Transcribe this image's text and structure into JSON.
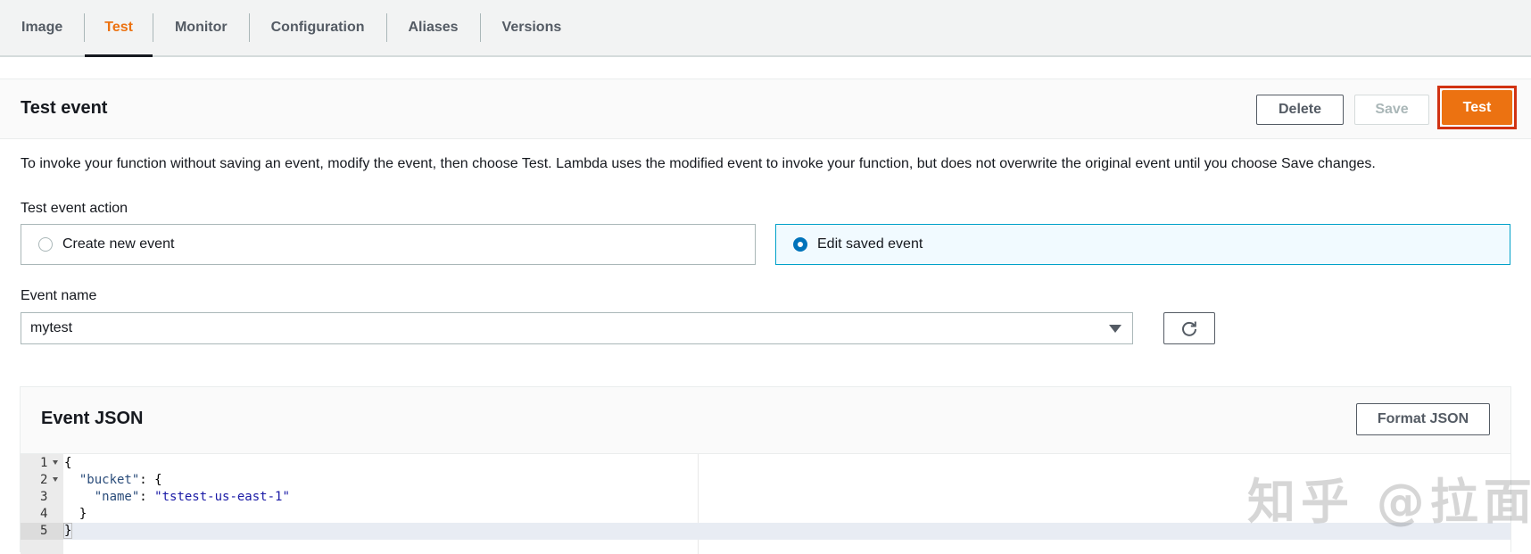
{
  "tabs": [
    {
      "label": "Image",
      "active": false
    },
    {
      "label": "Test",
      "active": true
    },
    {
      "label": "Monitor",
      "active": false
    },
    {
      "label": "Configuration",
      "active": false
    },
    {
      "label": "Aliases",
      "active": false
    },
    {
      "label": "Versions",
      "active": false
    }
  ],
  "header": {
    "title": "Test event",
    "delete_label": "Delete",
    "save_label": "Save",
    "test_label": "Test"
  },
  "description": "To invoke your function without saving an event, modify the event, then choose Test. Lambda uses the modified event to invoke your function, but does not overwrite the original event until you choose Save changes.",
  "test_event_action": {
    "label": "Test event action",
    "options": [
      {
        "label": "Create new event",
        "selected": false
      },
      {
        "label": "Edit saved event",
        "selected": true
      }
    ]
  },
  "event_name": {
    "label": "Event name",
    "value": "mytest"
  },
  "event_json": {
    "title": "Event JSON",
    "format_label": "Format JSON",
    "lines": [
      {
        "num": "1"
      },
      {
        "num": "2"
      },
      {
        "num": "3"
      },
      {
        "num": "4"
      },
      {
        "num": "5"
      }
    ],
    "key_bucket": "\"bucket\"",
    "key_name": "\"name\"",
    "value_name": "\"tstest-us-east-1\""
  },
  "watermark": "知乎 @拉面",
  "colors": {
    "accent": "#ec7211",
    "highlight": "#d13212",
    "selected_radio": "#0073bb"
  }
}
